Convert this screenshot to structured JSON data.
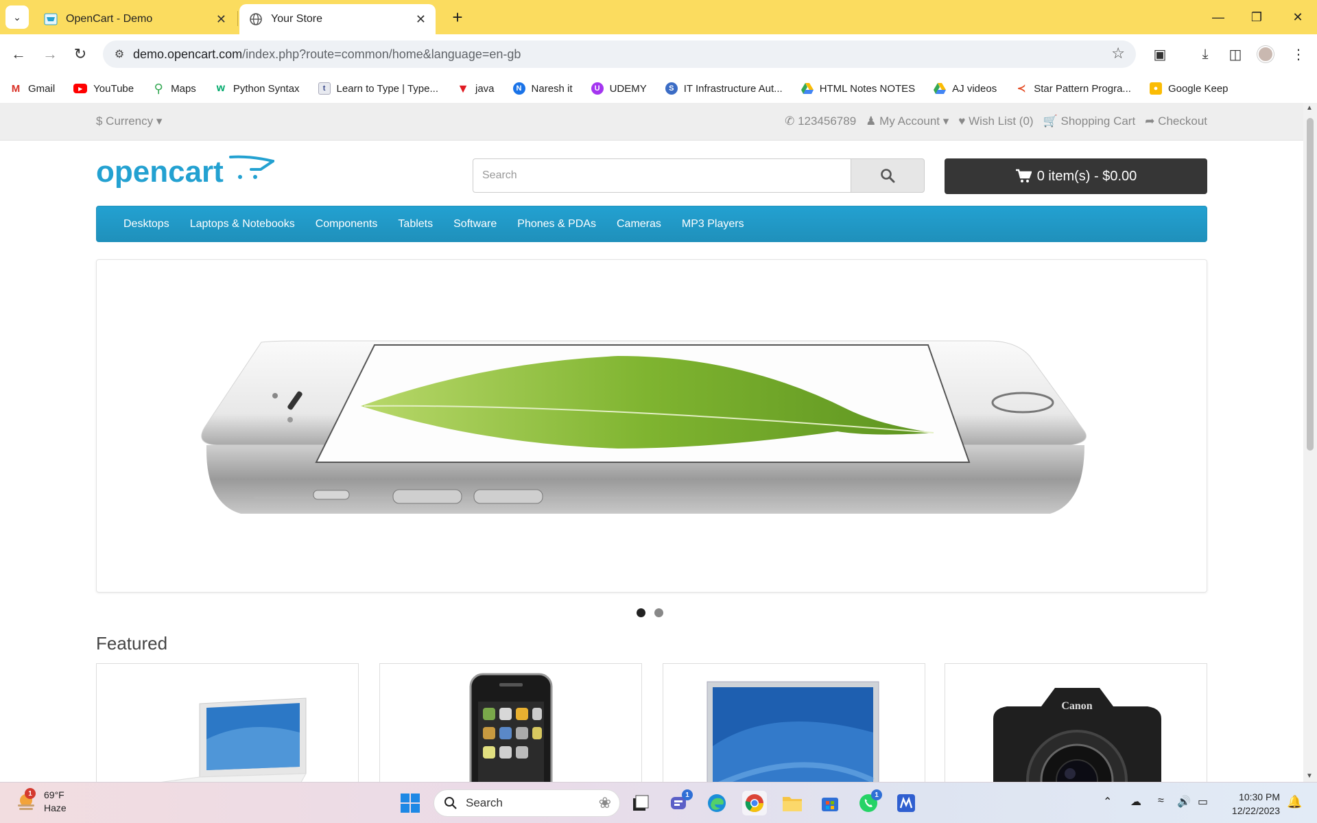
{
  "browser": {
    "tabs": [
      {
        "title": "OpenCart - Demo",
        "active": false
      },
      {
        "title": "Your Store",
        "active": true
      }
    ],
    "url_host": "demo.opencart.com",
    "url_path": "/index.php?route=common/home&language=en-gb",
    "bookmarks": [
      {
        "label": "Gmail",
        "icon": "gmail-icon"
      },
      {
        "label": "YouTube",
        "icon": "youtube-icon"
      },
      {
        "label": "Maps",
        "icon": "maps-icon"
      },
      {
        "label": "Python Syntax",
        "icon": "w3schools-icon"
      },
      {
        "label": "Learn to Type | Type...",
        "icon": "typing-icon"
      },
      {
        "label": "java",
        "icon": "java-icon"
      },
      {
        "label": "Naresh it",
        "icon": "naresh-icon"
      },
      {
        "label": "UDEMY",
        "icon": "udemy-icon"
      },
      {
        "label": "IT Infrastructure Aut...",
        "icon": "site-icon"
      },
      {
        "label": "HTML Notes NOTES",
        "icon": "drive-icon"
      },
      {
        "label": "AJ videos",
        "icon": "drive-icon"
      },
      {
        "label": "Star Pattern Progra...",
        "icon": "star-pattern-icon"
      },
      {
        "label": "Google Keep",
        "icon": "keep-icon"
      }
    ]
  },
  "store": {
    "currency_label": "$ Currency",
    "phone": "123456789",
    "my_account": "My Account",
    "wish_list": "Wish List (0)",
    "shopping_cart": "Shopping Cart",
    "checkout": "Checkout",
    "logo_text": "opencart",
    "search_placeholder": "Search",
    "cart_button": "0 item(s) - $0.00",
    "menu": [
      "Desktops",
      "Laptops & Notebooks",
      "Components",
      "Tablets",
      "Software",
      "Phones & PDAs",
      "Cameras",
      "MP3 Players"
    ],
    "slider": {
      "slides": 2,
      "active_slide": 1,
      "image": "iphone-6-leaf-banner"
    },
    "featured_title": "Featured",
    "featured_products": [
      {
        "image": "macbook-product-image"
      },
      {
        "image": "iphone-product-image"
      },
      {
        "image": "apple-cinema-display-image"
      },
      {
        "image": "canon-eos-5d-image"
      }
    ]
  },
  "taskbar": {
    "weather_temp": "69°F",
    "weather_desc": "Haze",
    "weather_badge": "1",
    "search_label": "Search",
    "teams_badge": "1",
    "whatsapp_badge": "1",
    "time": "10:30 PM",
    "date": "12/22/2023"
  },
  "colors": {
    "titlebar": "#fbdc5f",
    "menu_blue": "#229ac8",
    "cart_dark": "#363636",
    "logo_blue": "#23a1d1"
  }
}
